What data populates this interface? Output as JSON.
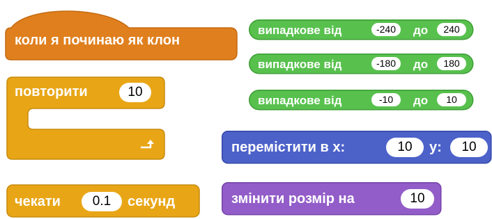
{
  "colors": {
    "events": "#e07f1d",
    "events_stroke": "#c46a10",
    "control": "#e8a617",
    "control_stroke": "#c78a0c",
    "operators": "#58c14e",
    "operators_stroke": "#3c9d33",
    "motion": "#4c62c9",
    "motion_stroke": "#3447a8",
    "looks": "#925dc8",
    "looks_stroke": "#7542a9"
  },
  "blocks": {
    "clone_hat": {
      "label": "коли я починаю як клон"
    },
    "repeat": {
      "label": "повторити",
      "times": "10",
      "arrow_icon": "loop-arrow-icon"
    },
    "wait": {
      "label_prefix": "чекати",
      "seconds": "0.1",
      "label_suffix": "секунд"
    },
    "random1": {
      "label": "випадкове від",
      "from": "-240",
      "to_label": "до",
      "to": "240"
    },
    "random2": {
      "label": "випадкове від",
      "from": "-180",
      "to_label": "до",
      "to": "180"
    },
    "random3": {
      "label": "випадкове від",
      "from": "-10",
      "to_label": "до",
      "to": "10"
    },
    "goto": {
      "label": "перемістити в x:",
      "x": "10",
      "y_label": "y:",
      "y": "10"
    },
    "size": {
      "label": "змінити розмір на",
      "value": "10"
    }
  }
}
